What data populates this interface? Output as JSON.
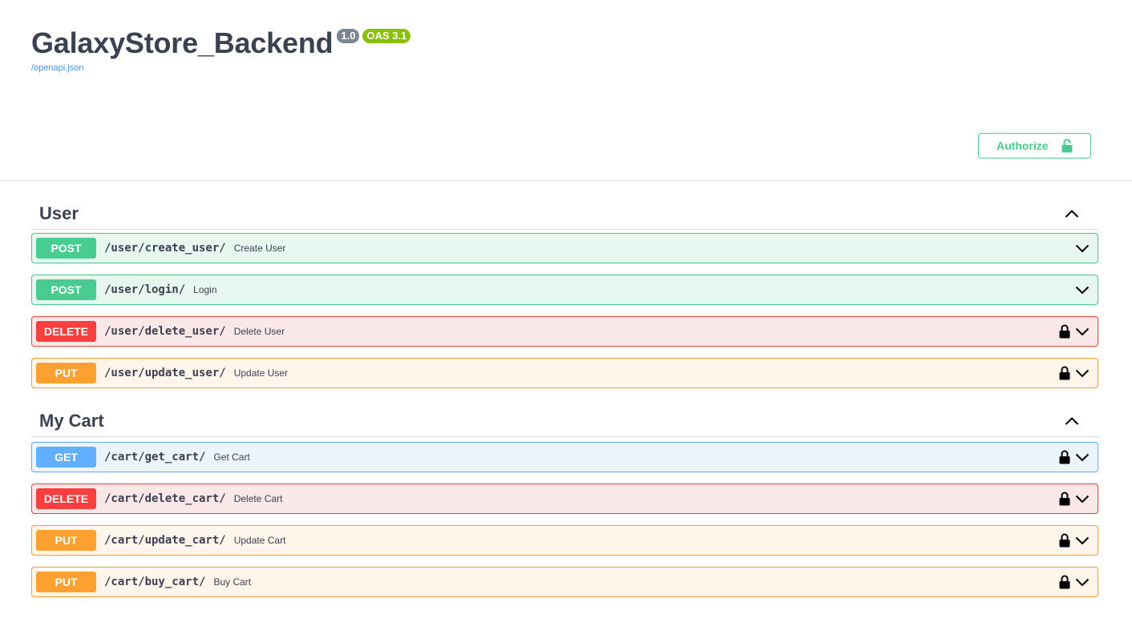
{
  "info": {
    "title": "GalaxyStore_Backend",
    "version": "1.0",
    "oas": "OAS 3.1",
    "spec_link": "/openapi.json"
  },
  "authorize": {
    "label": "Authorize"
  },
  "colors": {
    "post": "#49cc90",
    "delete": "#f93e3e",
    "put": "#fca130",
    "get": "#61affe"
  },
  "sections": [
    {
      "name": "User",
      "operations": [
        {
          "method": "POST",
          "path": "/user/create_user/",
          "summary": "Create User",
          "locked": false
        },
        {
          "method": "POST",
          "path": "/user/login/",
          "summary": "Login",
          "locked": false
        },
        {
          "method": "DELETE",
          "path": "/user/delete_user/",
          "summary": "Delete User",
          "locked": true
        },
        {
          "method": "PUT",
          "path": "/user/update_user/",
          "summary": "Update User",
          "locked": true
        }
      ]
    },
    {
      "name": "My Cart",
      "operations": [
        {
          "method": "GET",
          "path": "/cart/get_cart/",
          "summary": "Get Cart",
          "locked": true
        },
        {
          "method": "DELETE",
          "path": "/cart/delete_cart/",
          "summary": "Delete Cart",
          "locked": true
        },
        {
          "method": "PUT",
          "path": "/cart/update_cart/",
          "summary": "Update Cart",
          "locked": true
        },
        {
          "method": "PUT",
          "path": "/cart/buy_cart/",
          "summary": "Buy Cart",
          "locked": true
        }
      ]
    }
  ]
}
